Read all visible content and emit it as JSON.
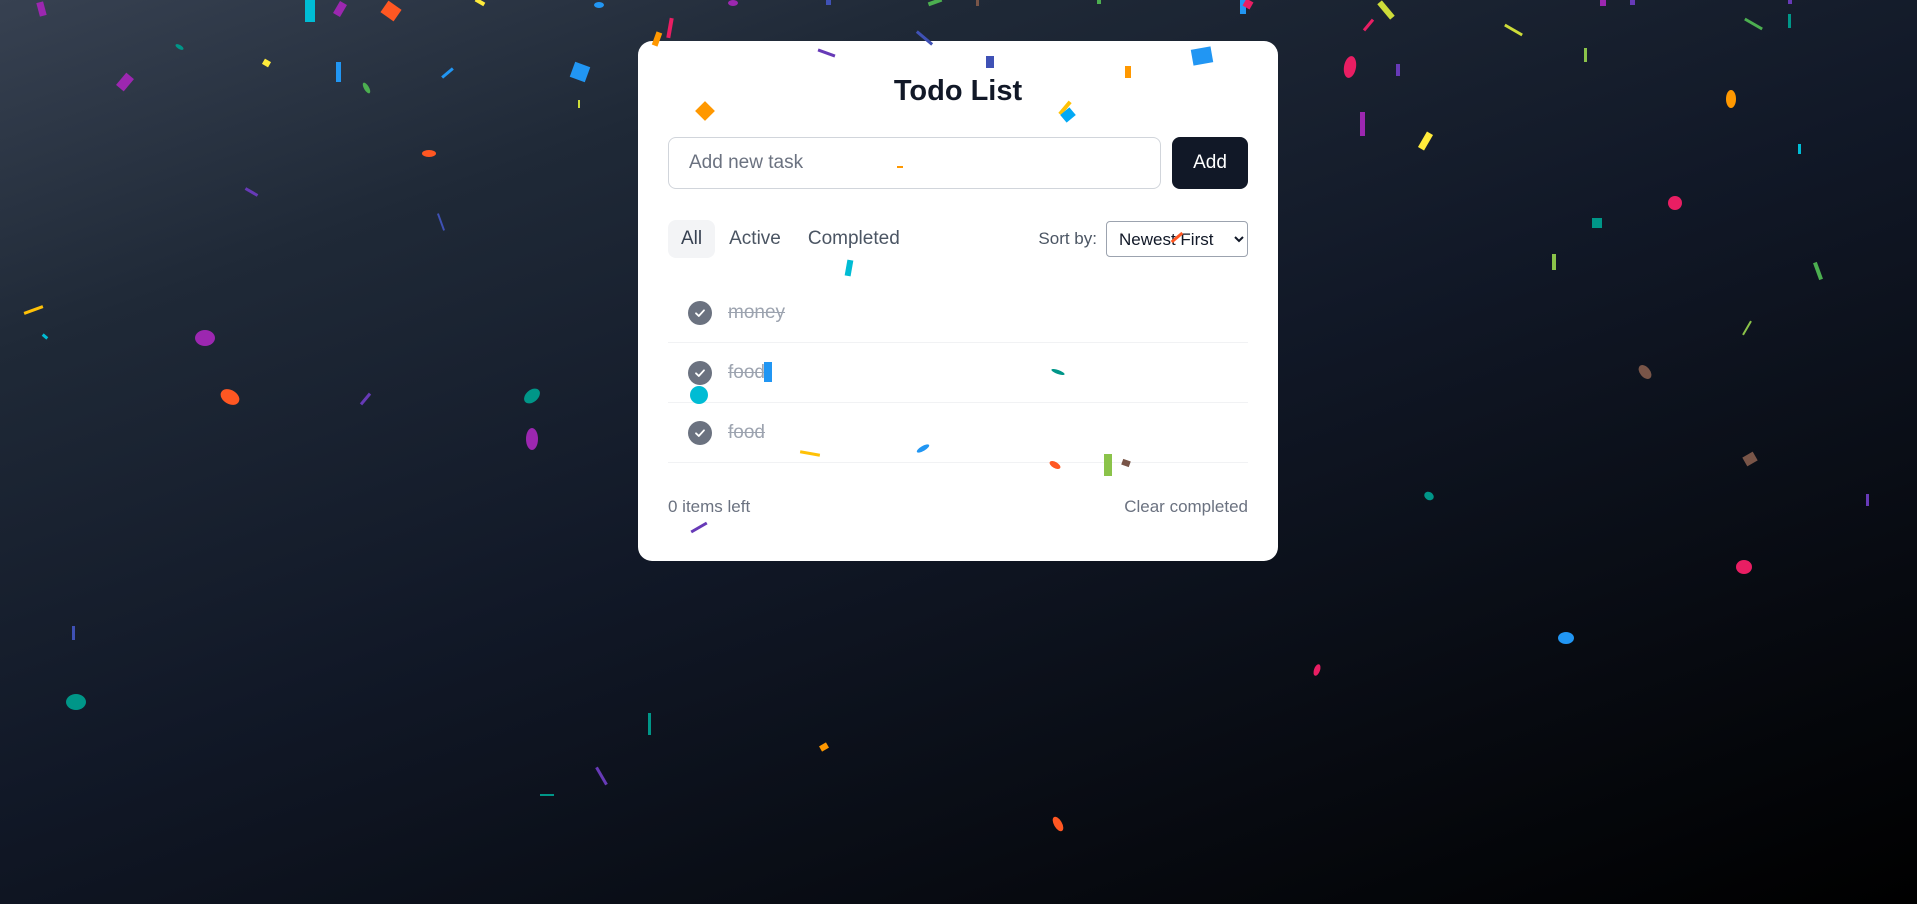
{
  "app": {
    "title": "Todo List"
  },
  "input": {
    "placeholder": "Add new task",
    "value": ""
  },
  "add_button": {
    "label": "Add"
  },
  "filters": [
    {
      "label": "All",
      "active": true
    },
    {
      "label": "Active",
      "active": false
    },
    {
      "label": "Completed",
      "active": false
    }
  ],
  "sort": {
    "label": "Sort by:",
    "selected": "Newest First"
  },
  "todos": [
    {
      "text": "money",
      "completed": true
    },
    {
      "text": "food",
      "completed": true
    },
    {
      "text": "food",
      "completed": true
    }
  ],
  "footer": {
    "items_left": "0 items left",
    "clear_label": "Clear completed"
  },
  "theme": {
    "accent": "#111827",
    "check_color": "#6b7280",
    "completed_text": "#9ca3af",
    "confetti_colors": [
      "#9c27b0",
      "#00bcd4",
      "#ff5722",
      "#2196f3",
      "#ffeb3b",
      "#4caf50",
      "#e91e63",
      "#ff9800",
      "#009688",
      "#673ab7",
      "#3f51b5",
      "#8bc34a",
      "#795548",
      "#ffc107",
      "#cddc39",
      "#03a9f4"
    ]
  },
  "icons": {
    "check": "check-icon",
    "dropdown": "chevron-down-icon",
    "confetti": "confetti-piece"
  }
}
